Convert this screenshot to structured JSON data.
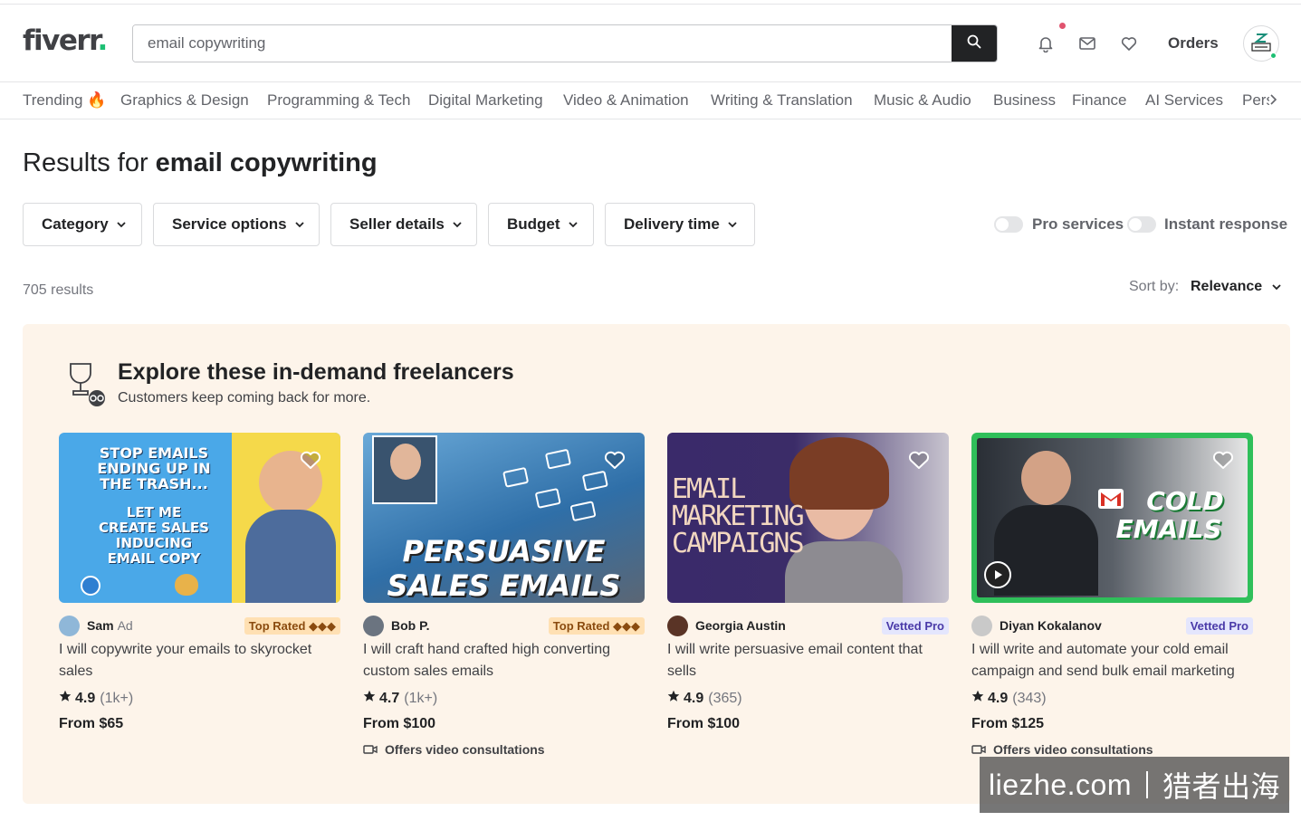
{
  "header": {
    "logo": "fiverr",
    "logo_dot": ".",
    "search_value": "email copywriting",
    "orders_label": "Orders"
  },
  "categories": [
    "Trending 🔥",
    "Graphics & Design",
    "Programming & Tech",
    "Digital Marketing",
    "Video & Animation",
    "Writing & Translation",
    "Music & Audio",
    "Business",
    "Finance",
    "AI Services",
    "Pers"
  ],
  "results": {
    "prefix": "Results for ",
    "query": "email copywriting",
    "count": "705 results",
    "sort_label": "Sort by:",
    "sort_value": "Relevance"
  },
  "filters": [
    "Category",
    "Service options",
    "Seller details",
    "Budget",
    "Delivery time"
  ],
  "toggles": [
    "Pro services",
    "Instant response"
  ],
  "promo": {
    "title": "Explore these in-demand freelancers",
    "subtitle": "Customers keep coming back for more."
  },
  "gigs": [
    {
      "seller": "Sam",
      "ad": "Ad",
      "badge": "Top Rated ◆◆◆",
      "title": "I will copywrite your emails to skyrocket sales",
      "rating": "4.9",
      "reviews": "(1k+)",
      "price": "From $65",
      "thumb_text": [
        "STOP EMAILS",
        "ENDING UP IN",
        "THE TRASH...",
        "LET ME",
        "CREATE SALES",
        "INDUCING",
        "EMAIL COPY"
      ]
    },
    {
      "seller": "Bob P.",
      "badge": "Top Rated ◆◆◆",
      "title": "I will craft hand crafted high converting custom sales emails",
      "rating": "4.7",
      "reviews": "(1k+)",
      "price": "From $100",
      "consult": "Offers video consultations",
      "thumb_text": [
        "PERSUASIVE",
        "SALES EMAILS"
      ]
    },
    {
      "seller": "Georgia Austin",
      "badge": "Vetted Pro",
      "title": "I will write persuasive email content that sells",
      "rating": "4.9",
      "reviews": "(365)",
      "price": "From $100",
      "thumb_text": [
        "EMAIL",
        "MARKETING",
        "CAMPAIGNS"
      ]
    },
    {
      "seller": "Diyan Kokalanov",
      "badge": "Vetted Pro",
      "title": "I will write and automate your cold email campaign and send bulk email marketing",
      "rating": "4.9",
      "reviews": "(343)",
      "price": "From $125",
      "consult": "Offers video consultations",
      "thumb_text": [
        "COLD",
        "EMAILS"
      ]
    }
  ],
  "watermark": {
    "left": "liezhe.com",
    "right": "猎者出海"
  },
  "colors": {
    "brand_green": "#1dbf73",
    "promo_bg": "#fdf4ea",
    "top_rated_bg": "#ffe0b3",
    "vetted_bg": "#e4e6fd"
  }
}
